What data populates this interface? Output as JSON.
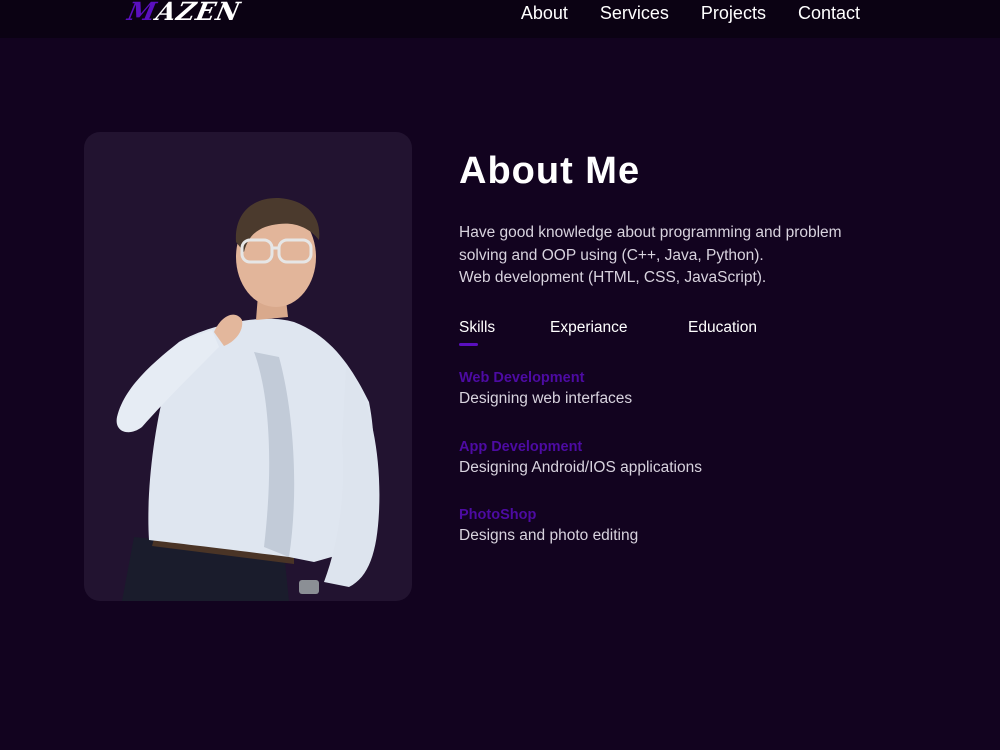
{
  "header": {
    "logo_text": "MAZEN",
    "nav": [
      "About",
      "Services",
      "Projects",
      "Contact"
    ]
  },
  "about": {
    "title": "About Me",
    "description": [
      "Have good knowledge about programming and problem",
      "solving and OOP using (C++, Java, Python).",
      "Web development (HTML, CSS, JavaScript)."
    ],
    "tabs": [
      "Skills",
      "Experiance",
      "Education"
    ],
    "active_tab": "Skills",
    "skills": [
      {
        "title": "Web Development",
        "desc": "Designing web interfaces"
      },
      {
        "title": "App Development",
        "desc": "Designing Android/IOS applications"
      },
      {
        "title": "PhotoShop",
        "desc": "Designs and photo editing"
      }
    ]
  },
  "colors": {
    "background": "#12031f",
    "navbar": "#0b0213",
    "accent": "#5a0fbf",
    "card": "#221330"
  }
}
